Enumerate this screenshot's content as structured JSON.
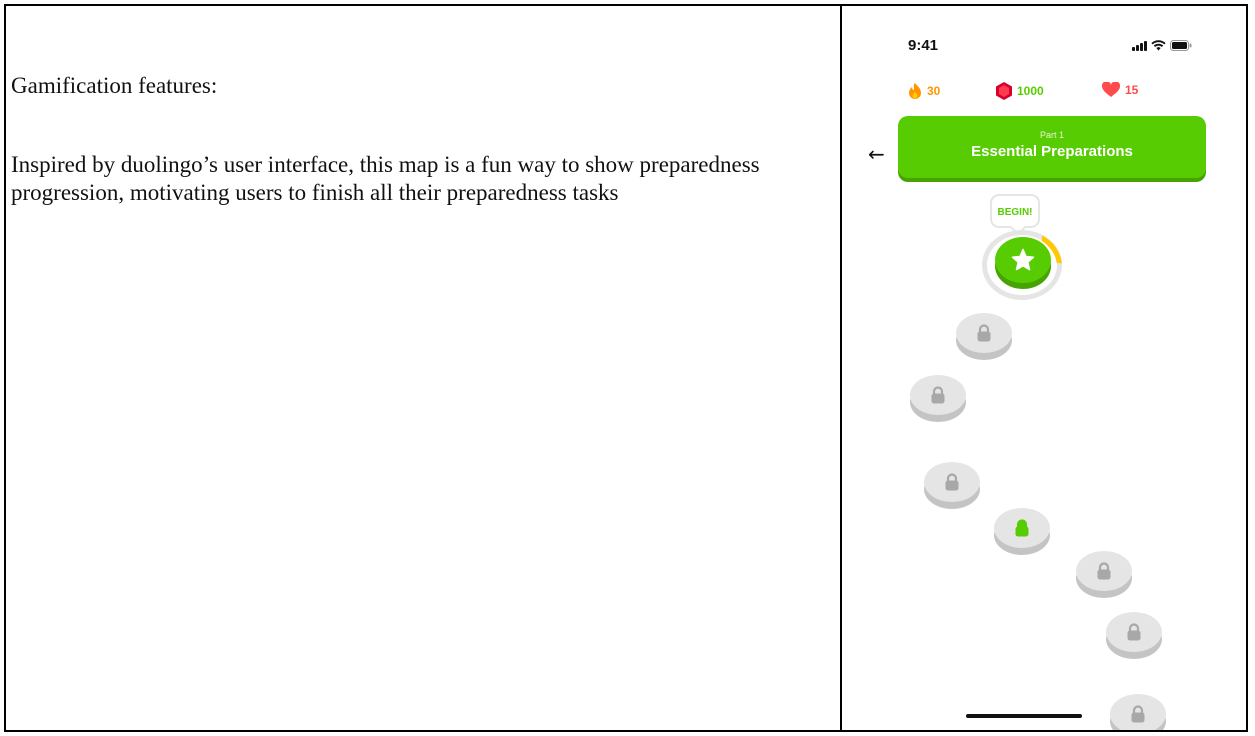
{
  "document": {
    "heading": "Gamification features:",
    "description": "Inspired by duolingo’s user interface, this map is a fun way to show preparedness progression, motivating users to finish all their preparedness tasks"
  },
  "phone": {
    "status_bar": {
      "time": "9:41",
      "icons": [
        "signal-icon",
        "wifi-icon",
        "battery-icon"
      ]
    },
    "stats": {
      "streak": {
        "icon": "flame-icon",
        "value": "30",
        "color": "#ff9600"
      },
      "gems": {
        "icon": "gem-icon",
        "value": "1000",
        "color": "#58cc02"
      },
      "hearts": {
        "icon": "heart-icon",
        "value": "15",
        "color": "#ff4b4b"
      }
    },
    "back_icon": "arrow-left-icon",
    "unit": {
      "part": "Part 1",
      "title": "Essential Preparations",
      "color": "#58cc02"
    },
    "start_tooltip": "BEGIN!",
    "start_node": {
      "icon": "star-icon",
      "progress": 0.1
    },
    "path_nodes": [
      {
        "state": "locked",
        "icon": "lock-icon"
      },
      {
        "state": "locked",
        "icon": "lock-icon"
      },
      {
        "state": "locked",
        "icon": "lock-icon"
      },
      {
        "state": "locked-highlight",
        "icon": "lock-icon"
      },
      {
        "state": "locked",
        "icon": "lock-icon"
      },
      {
        "state": "locked",
        "icon": "lock-icon"
      },
      {
        "state": "locked",
        "icon": "lock-icon"
      }
    ]
  }
}
